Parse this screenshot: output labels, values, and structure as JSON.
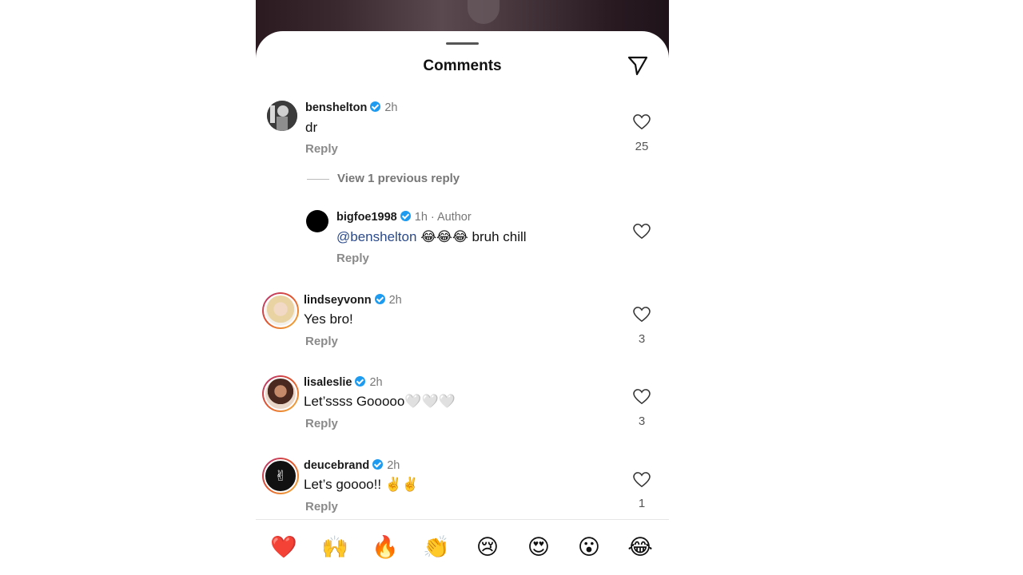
{
  "sheet": {
    "title": "Comments"
  },
  "comments": [
    {
      "username": "benshelton",
      "time": "2h",
      "text": "dr",
      "reply_label": "Reply",
      "likes": "25"
    },
    {
      "username": "bigfoe1998",
      "time": "1h · Author",
      "mention": "@benshelton",
      "text": "😂😂😂 bruh chill",
      "reply_label": "Reply"
    },
    {
      "username": "lindseyvonn",
      "time": "2h",
      "text": "Yes bro!",
      "reply_label": "Reply",
      "likes": "3"
    },
    {
      "username": "lisaleslie",
      "time": "2h",
      "text": "Let’ssss Gooooo🤍🤍🤍",
      "reply_label": "Reply",
      "likes": "3"
    },
    {
      "username": "deucebrand",
      "time": "2h",
      "text": "Let’s goooo!! ✌️✌️",
      "reply_label": "Reply",
      "likes": "1"
    }
  ],
  "view_replies": "View 1 previous reply",
  "reactions": [
    "❤️",
    "🙌",
    "🔥",
    "👏",
    "😢",
    "😍",
    "😮",
    "😂"
  ],
  "colors": {
    "verified": "#1d9bf0",
    "mention": "#2b4a8a"
  }
}
